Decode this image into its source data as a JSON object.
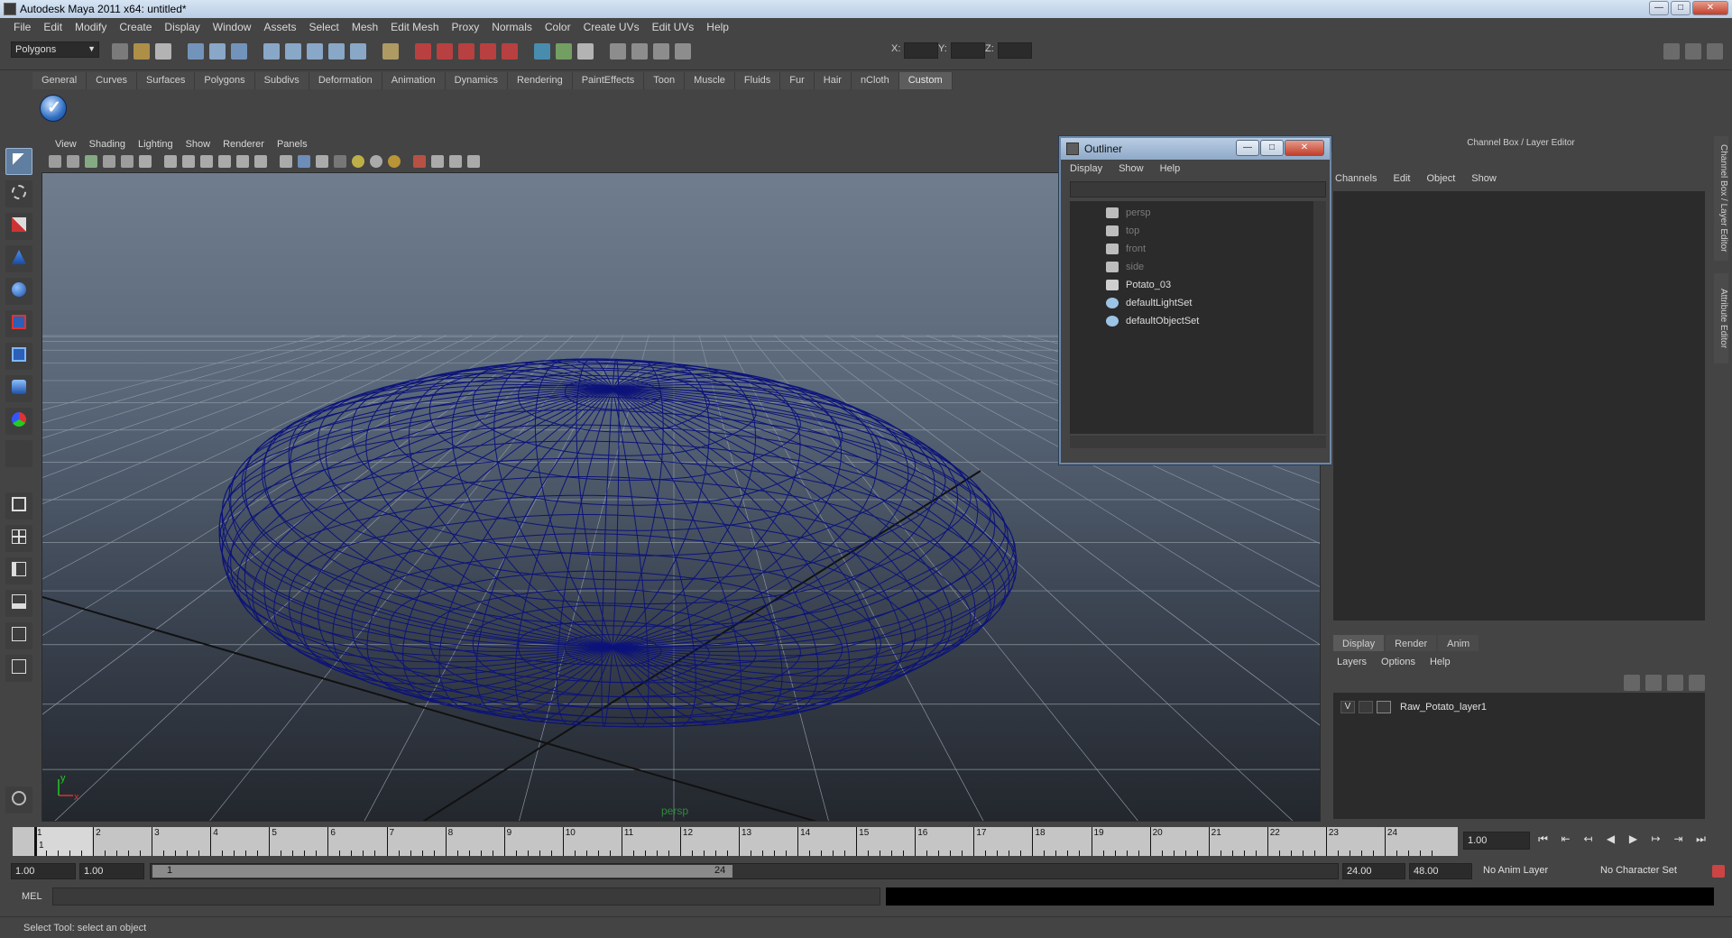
{
  "window": {
    "title": "Autodesk Maya 2011 x64: untitled*"
  },
  "menubar": [
    "File",
    "Edit",
    "Modify",
    "Create",
    "Display",
    "Window",
    "Assets",
    "Select",
    "Mesh",
    "Edit Mesh",
    "Proxy",
    "Normals",
    "Color",
    "Create UVs",
    "Edit UVs",
    "Help"
  ],
  "statusline": {
    "mode": "Polygons",
    "x_label": "X:",
    "y_label": "Y:",
    "z_label": "Z:"
  },
  "shelf": {
    "tabs": [
      "General",
      "Curves",
      "Surfaces",
      "Polygons",
      "Subdivs",
      "Deformation",
      "Animation",
      "Dynamics",
      "Rendering",
      "PaintEffects",
      "Toon",
      "Muscle",
      "Fluids",
      "Fur",
      "Hair",
      "nCloth",
      "Custom"
    ],
    "active_tab": "Custom"
  },
  "viewport": {
    "menu": [
      "View",
      "Shading",
      "Lighting",
      "Show",
      "Renderer",
      "Panels"
    ],
    "camera_label": "persp",
    "axis_x": "x",
    "axis_y": "y"
  },
  "outliner": {
    "title": "Outliner",
    "menu": [
      "Display",
      "Show",
      "Help"
    ],
    "items": [
      {
        "label": "persp",
        "dim": true,
        "icon": "camera-icon"
      },
      {
        "label": "top",
        "dim": true,
        "icon": "camera-icon"
      },
      {
        "label": "front",
        "dim": true,
        "icon": "camera-icon"
      },
      {
        "label": "side",
        "dim": true,
        "icon": "camera-icon"
      },
      {
        "label": "Potato_03",
        "dim": false,
        "icon": "mesh-icon"
      },
      {
        "label": "defaultLightSet",
        "dim": false,
        "icon": "set-icon"
      },
      {
        "label": "defaultObjectSet",
        "dim": false,
        "icon": "set-icon"
      }
    ]
  },
  "channel_box": {
    "title": "Channel Box / Layer Editor",
    "menu": [
      "Channels",
      "Edit",
      "Object",
      "Show"
    ]
  },
  "layer_editor": {
    "tabs": [
      "Display",
      "Render",
      "Anim"
    ],
    "active_tab": "Display",
    "menu": [
      "Layers",
      "Options",
      "Help"
    ],
    "layer": {
      "visibility": "V",
      "name": "Raw_Potato_layer1"
    }
  },
  "side_tabs": [
    "Channel Box / Layer Editor",
    "Attribute Editor"
  ],
  "timeline": {
    "ticks": [
      "1",
      "2",
      "3",
      "4",
      "5",
      "6",
      "7",
      "8",
      "9",
      "10",
      "11",
      "12",
      "13",
      "14",
      "15",
      "16",
      "17",
      "18",
      "19",
      "20",
      "21",
      "22",
      "23",
      "24"
    ],
    "current_frame": "1",
    "current_time_field": "1.00"
  },
  "range": {
    "start": "1.00",
    "playback_start": "1.00",
    "range_start": "1",
    "range_end": "24",
    "playback_end": "24.00",
    "end": "48.00",
    "anim_layer": "No Anim Layer",
    "character_set": "No Character Set"
  },
  "cmdline": {
    "label": "MEL"
  },
  "helpline": {
    "text": "Select Tool: select an object"
  },
  "colors": {
    "wire": "#0c137a",
    "selection": "#5f7ea0",
    "cmd_out": "#000000"
  }
}
